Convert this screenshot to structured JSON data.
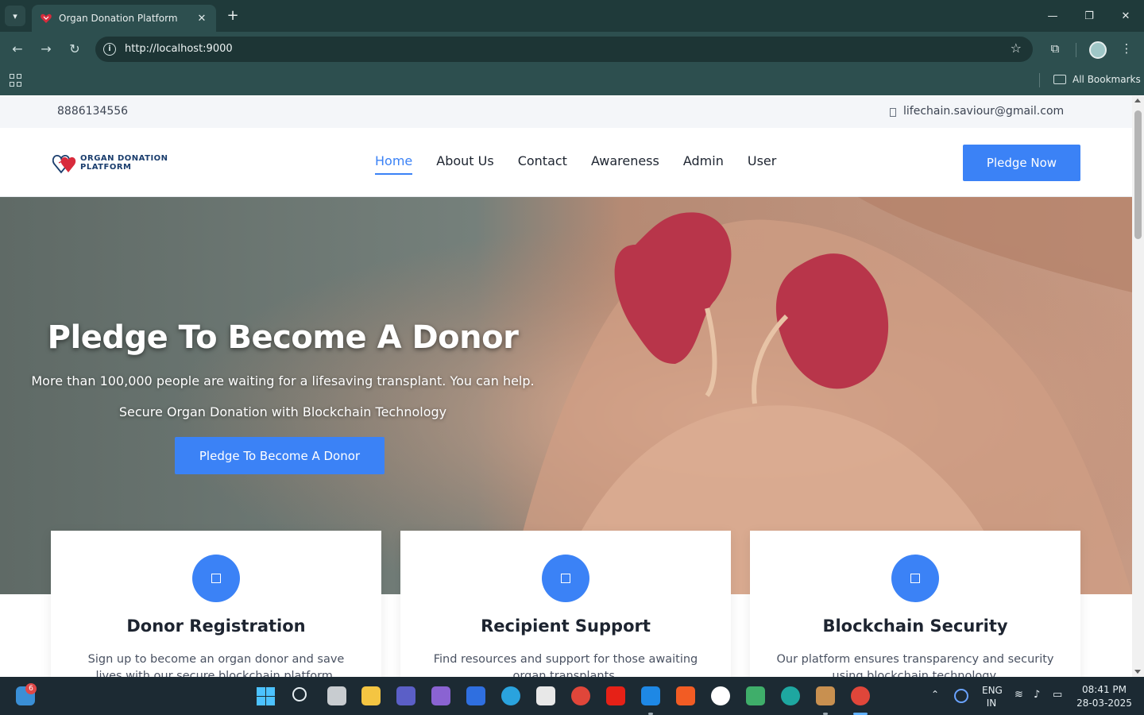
{
  "browser": {
    "tab_title": "Organ Donation Platform",
    "url": "http://localhost:9000",
    "bookmarks_label": "All Bookmarks"
  },
  "site": {
    "topbar": {
      "phone": "8886134556",
      "email": "lifechain.saviour@gmail.com"
    },
    "logo": {
      "line1": "ORGAN DONATION",
      "line2": "PLATFORM"
    },
    "nav": [
      {
        "label": "Home",
        "active": true
      },
      {
        "label": "About Us",
        "active": false
      },
      {
        "label": "Contact",
        "active": false
      },
      {
        "label": "Awareness",
        "active": false
      },
      {
        "label": "Admin",
        "active": false
      },
      {
        "label": "User",
        "active": false
      }
    ],
    "pledge_button": "Pledge Now",
    "hero": {
      "title": "Pledge To Become A Donor",
      "subtitle1": "More than 100,000 people are waiting for a lifesaving transplant. You can help.",
      "subtitle2": "Secure Organ Donation with Blockchain Technology",
      "cta": "Pledge To Become A Donor"
    },
    "cards": [
      {
        "title": "Donor Registration",
        "text": "Sign up to become an organ donor and save lives with our secure blockchain platform."
      },
      {
        "title": "Recipient Support",
        "text": "Find resources and support for those awaiting organ transplants."
      },
      {
        "title": "Blockchain Security",
        "text": "Our platform ensures transparency and security using blockchain technology."
      }
    ]
  },
  "taskbar": {
    "notification_count": "6",
    "lang_line1": "ENG",
    "lang_line2": "IN",
    "time": "08:41 PM",
    "date": "28-03-2025"
  },
  "colors": {
    "accent": "#3b82f6",
    "chrome": "#2d4f4f",
    "taskbar": "#1c2a33"
  }
}
